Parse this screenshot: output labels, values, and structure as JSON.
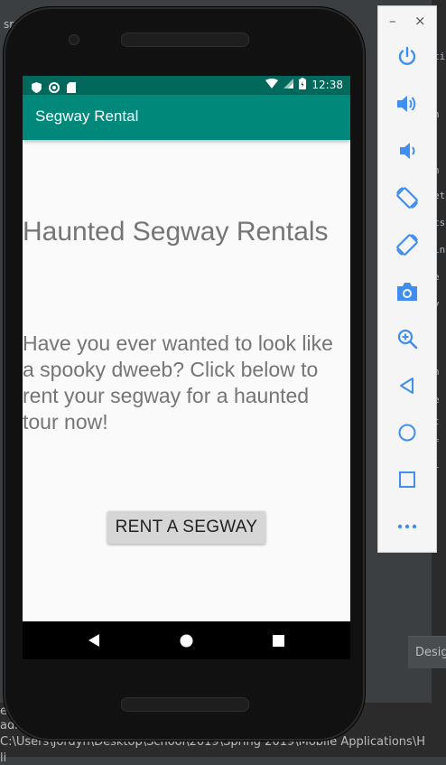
{
  "ide": {
    "top_left_text": "sr",
    "right_fragments": [
      "ti",
      "n",
      "n",
      "et",
      "ts",
      "in",
      "e",
      "y",
      "n",
      "e",
      "t",
      "f",
      "l"
    ],
    "design_tab": "Desig",
    "console_lines": [
      "ete",
      "adle",
      "C:\\Users\\Jordyn\\Desktop\\School\\2019\\Spring 2019\\Mobile Applications\\H",
      "li"
    ]
  },
  "status_bar": {
    "time": "12:38"
  },
  "app_bar": {
    "title": "Segway Rental"
  },
  "content": {
    "heading": "Haunted Segway Rentals",
    "description": "Have you ever wanted to look like a spooky dweeb? Click below to rent your segway for a haunted tour now!",
    "rent_button": "RENT A SEGWAY"
  },
  "emulator_toolbar": {
    "minimize": "–",
    "close": "×",
    "tools": [
      "power-icon",
      "volume-up-icon",
      "volume-down-icon",
      "rotate-left-icon",
      "rotate-right-icon",
      "camera-icon",
      "zoom-icon",
      "back-icon",
      "home-icon",
      "overview-icon",
      "more-icon"
    ]
  },
  "colors": {
    "status_bar": "#00695c",
    "app_bar": "#00897b",
    "text_gray": "#757575",
    "button_bg": "#d6d6d6",
    "icon_color": "#3f8ef1"
  }
}
